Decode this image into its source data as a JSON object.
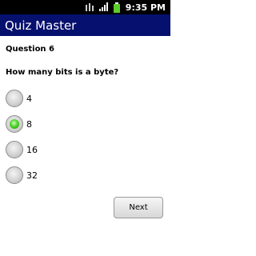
{
  "status_bar": {
    "time": "9:35 PM",
    "icons": [
      "usb-icon",
      "signal-icon",
      "battery-icon"
    ]
  },
  "app": {
    "title": "Quiz Master",
    "title_bar_color": "#06106e"
  },
  "quiz": {
    "question_number": "Question 6",
    "question_text": "How many bits is a byte?",
    "options": [
      {
        "label": "4",
        "selected": false
      },
      {
        "label": "8",
        "selected": true
      },
      {
        "label": "16",
        "selected": false
      },
      {
        "label": "32",
        "selected": false
      }
    ],
    "selected_color": "#4fd62a"
  },
  "actions": {
    "next_label": "Next"
  }
}
